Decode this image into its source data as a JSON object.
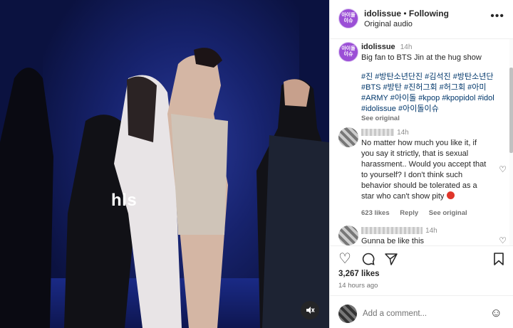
{
  "media": {
    "watermark": "hls",
    "mute_icon": "speaker-muted-icon"
  },
  "post": {
    "avatar_text": "아이돌\n이슈",
    "username": "idolissue",
    "dot": "•",
    "follow_status": "Following",
    "audio": "Original audio"
  },
  "caption": {
    "username": "idolissue",
    "age": "14h",
    "text": "Big fan to BTS Jin at the hug show",
    "hashtags": "#진 #방탄소년단진 #김석진 #방탄소년단 #BTS #방탄 #진허그회 #허그회 #아미 #ARMY #아이돌 #kpop #kpopidol #idol #idolissue #아이돌이슈",
    "see_original": "See original"
  },
  "comments": [
    {
      "age": "14h",
      "text": "No matter how much you like it, if you say it strictly, that is sexual harassment.. Would you accept that to yourself? I don't think such behavior should be tolerated as a star who can't show pity",
      "likes": "623 likes",
      "reply": "Reply",
      "see_original": "See original"
    },
    {
      "age": "14h",
      "text": "Gunna be like this"
    }
  ],
  "actions": {
    "likes": "3,267 likes",
    "time": "14 hours ago"
  },
  "add_comment": {
    "placeholder": "Add a comment..."
  }
}
